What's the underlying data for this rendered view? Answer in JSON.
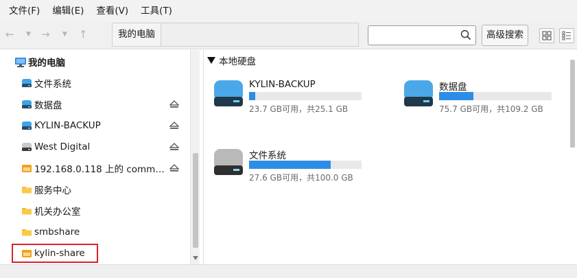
{
  "menu": [
    "文件(F)",
    "编辑(E)",
    "查看(V)",
    "工具(T)"
  ],
  "toolbar": {
    "back_glyph": "←",
    "forward_glyph": "→",
    "up_glyph": "↑",
    "dropdown_glyph": "▼",
    "path": [
      "我的电脑"
    ],
    "search_value": "",
    "advanced_search": "高级搜索",
    "icons": [
      "back-arrow-icon",
      "forward-arrow-icon",
      "up-arrow-icon",
      "search-icon",
      "icon-view-icon",
      "list-view-icon"
    ]
  },
  "sidebar": {
    "root": "我的电脑",
    "items": [
      {
        "label": "文件系统",
        "icon": "drive-icon",
        "eject": false
      },
      {
        "label": "数据盘",
        "icon": "drive-icon",
        "eject": true
      },
      {
        "label": "KYLIN-BACKUP",
        "icon": "drive-icon",
        "eject": true
      },
      {
        "label": "West Digital",
        "icon": "usb-drive-icon",
        "eject": true
      },
      {
        "label": "192.168.0.118 上的 comm…",
        "icon": "network-share-icon",
        "eject": true
      },
      {
        "label": "服务中心",
        "icon": "folder-icon",
        "eject": false
      },
      {
        "label": "机关办公室",
        "icon": "folder-icon",
        "eject": false
      },
      {
        "label": "smbshare",
        "icon": "folder-icon",
        "eject": false
      },
      {
        "label": "kylin-share",
        "icon": "network-share-icon",
        "eject": false
      }
    ],
    "selected_highlight": "kylin-share"
  },
  "main": {
    "group_title": "本地硬盘",
    "disks": [
      {
        "name": "KYLIN-BACKUP",
        "info": "23.7 GB可用，共25.1 GB",
        "used_fraction": 0.056,
        "icon": "drive-icon-blue"
      },
      {
        "name": "数据盘",
        "info": "75.7 GB可用，共109.2 GB",
        "used_fraction": 0.31,
        "icon": "drive-icon-blue"
      },
      {
        "name": "文件系统",
        "info": "27.6 GB可用，共100.0 GB",
        "used_fraction": 0.72,
        "icon": "drive-icon-gray"
      }
    ]
  },
  "colors": {
    "accent": "#2d8de6",
    "highlight_border": "#d9212b",
    "drive_blue": "#4aa8e8",
    "folder_yellow": "#f5b82e",
    "share_orange": "#f0a020"
  }
}
